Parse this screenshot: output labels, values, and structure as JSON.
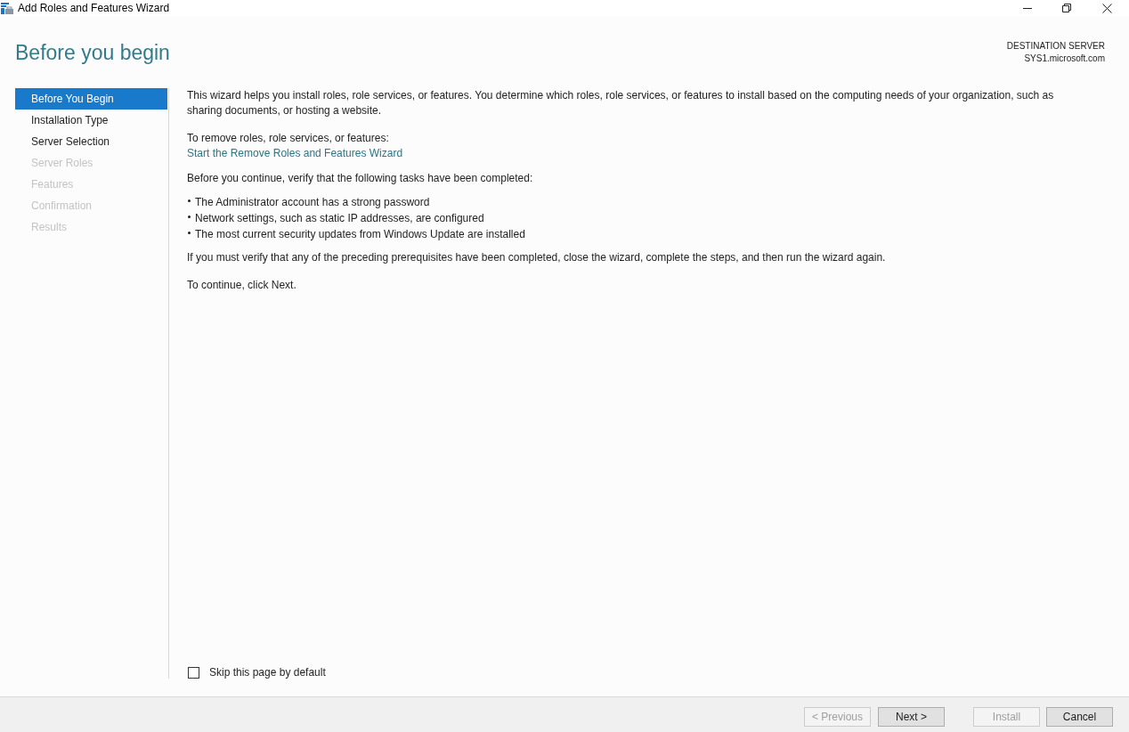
{
  "window": {
    "title": "Add Roles and Features Wizard"
  },
  "page_title": "Before you begin",
  "destination_server": {
    "label": "DESTINATION SERVER",
    "name": "SYS1.microsoft.com"
  },
  "steps": [
    {
      "label": "Before You Begin",
      "selected": true,
      "disabled": false
    },
    {
      "label": "Installation Type",
      "selected": false,
      "disabled": false
    },
    {
      "label": "Server Selection",
      "selected": false,
      "disabled": false
    },
    {
      "label": "Server Roles",
      "selected": false,
      "disabled": true
    },
    {
      "label": "Features",
      "selected": false,
      "disabled": true
    },
    {
      "label": "Confirmation",
      "selected": false,
      "disabled": true
    },
    {
      "label": "Results",
      "selected": false,
      "disabled": true
    }
  ],
  "content": {
    "intro": "This wizard helps you install roles, role services, or features. You determine which roles, role services, or features to install based on the computing needs of your organization, such as sharing documents, or hosting a website.",
    "remove_label": "To remove roles, role services, or features:",
    "remove_link": "Start the Remove Roles and Features Wizard",
    "verify_intro": "Before you continue, verify that the following tasks have been completed:",
    "tasks": [
      "The Administrator account has a strong password",
      "Network settings, such as static IP addresses, are configured",
      "The most current security updates from Windows Update are installed"
    ],
    "verify_note": "If you must verify that any of the preceding prerequisites have been completed, close the wizard, complete the steps, and then run the wizard again.",
    "continue_note": "To continue, click Next."
  },
  "skip_checkbox": {
    "label": "Skip this page by default",
    "checked": false
  },
  "navigation_buttons": [
    {
      "label": "< Previous",
      "disabled": true
    },
    {
      "label": "Next >",
      "disabled": false
    }
  ],
  "action_buttons": [
    {
      "label": "Install",
      "disabled": true
    },
    {
      "label": "Cancel",
      "disabled": false
    }
  ]
}
